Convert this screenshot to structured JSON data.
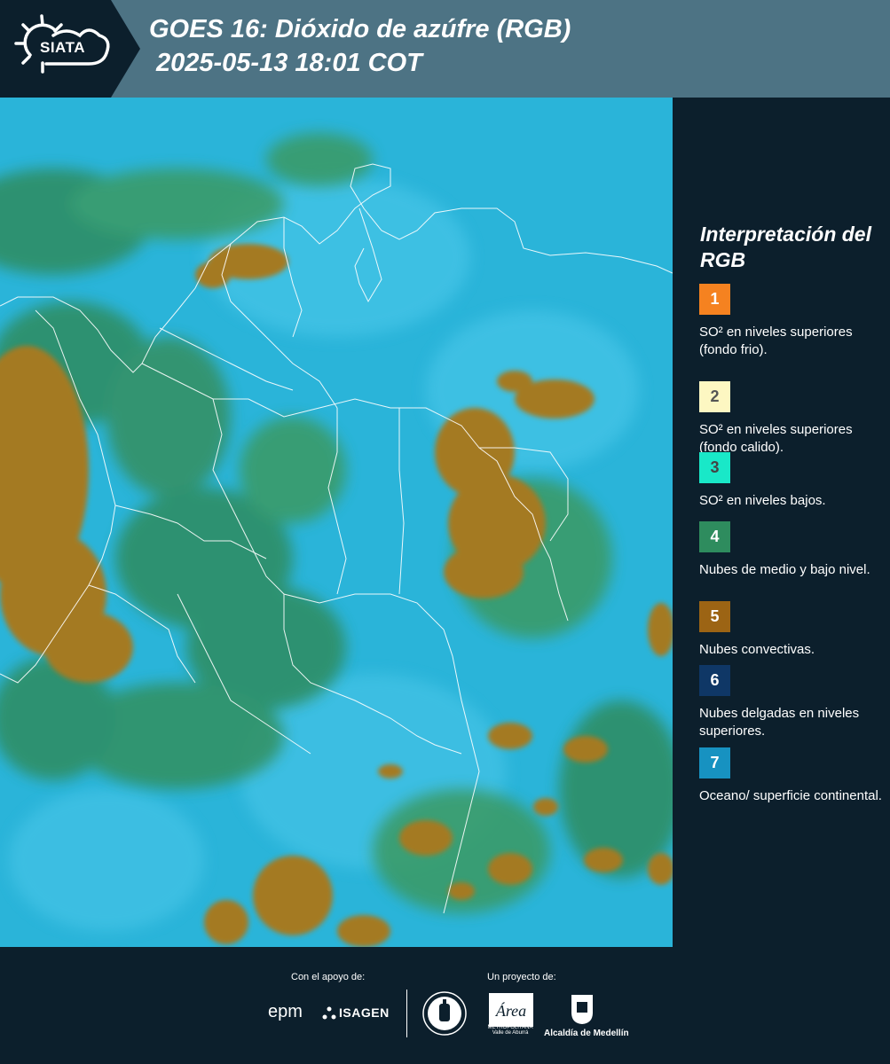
{
  "header": {
    "logo_text": "SIATA",
    "title": "GOES 16: Dióxido de azúfre (RGB)",
    "subtitle": "2025-05-13 18:01 COT"
  },
  "legend": {
    "title": "Interpretación del RGB",
    "items": [
      {
        "number": "1",
        "label": "SO² en niveles superiores (fondo frio).",
        "color": "#f58220",
        "text_color": "#ffffff"
      },
      {
        "number": "2",
        "label": "SO² en niveles superiores (fondo calido).",
        "color": "#fdf7c2",
        "text_color": "#555555"
      },
      {
        "number": "3",
        "label": "SO² en niveles bajos.",
        "color": "#19e8c8",
        "text_color": "#444444"
      },
      {
        "number": "4",
        "label": "Nubes de medio y bajo nivel.",
        "color": "#2e8c5e",
        "text_color": "#ffffff"
      },
      {
        "number": "5",
        "label": "Nubes convectivas.",
        "color": "#9c6414",
        "text_color": "#ffffff"
      },
      {
        "number": "6",
        "label": "Nubes delgadas en niveles superiores.",
        "color": "#0f3766",
        "text_color": "#ffffff"
      },
      {
        "number": "7",
        "label": "Oceano/ superficie continental.",
        "color": "#1792c1",
        "text_color": "#ffffff"
      }
    ]
  },
  "footer": {
    "support_label": "Con el apoyo de:",
    "project_label": "Un proyecto de:",
    "sponsors": [
      "epm",
      "ISAGEN"
    ],
    "partner_caption": "METROPOLITANA Valle de Aburrá",
    "partner_logo_text": "Área",
    "alcaldia": "Alcaldía de Medellín"
  },
  "colors": {
    "header_bg": "#4d7384",
    "dark_bg": "#0c1f2c",
    "ocean": "#2ab4d9",
    "cloud_green": "#2e8c5e",
    "cloud_brown": "#a47a22"
  }
}
